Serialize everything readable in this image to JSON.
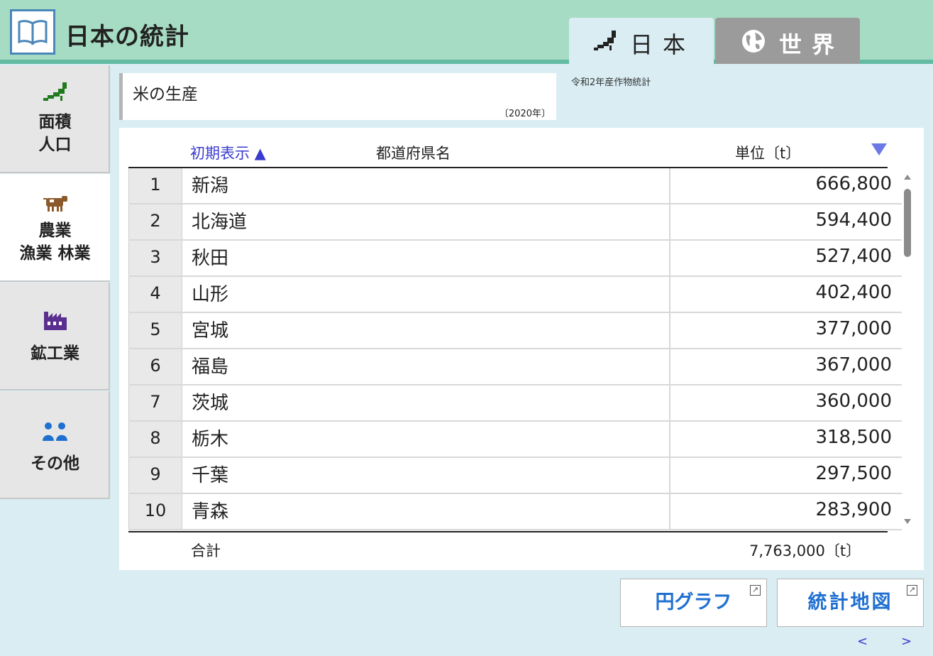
{
  "header": {
    "app_title": "日本の統計",
    "logo_icon": "book-icon",
    "tabs": [
      {
        "label": "日本",
        "icon": "japan-map-icon",
        "active": true
      },
      {
        "label": "世界",
        "icon": "globe-icon",
        "active": false
      }
    ]
  },
  "sidebar": {
    "items": [
      {
        "label_line1": "面積",
        "label_line2": "人口",
        "icon": "japan-map-icon",
        "active": false
      },
      {
        "label_line1": "農業",
        "label_line2": "漁業 林業",
        "icon": "cow-icon",
        "active": true
      },
      {
        "label_line1": "鉱工業",
        "label_line2": "",
        "icon": "factory-icon",
        "active": false
      },
      {
        "label_line1": "その他",
        "label_line2": "",
        "icon": "people-icon",
        "active": false
      }
    ]
  },
  "stat": {
    "title": "米の生産",
    "year": "〔2020年〕",
    "source": "令和2年産作物統計"
  },
  "table": {
    "headers": {
      "sort": "初期表示 ▲",
      "prefecture": "都道府県名",
      "unit": "単位〔t〕"
    },
    "rows": [
      {
        "rank": "1",
        "name": "新潟",
        "value": "666,800"
      },
      {
        "rank": "2",
        "name": "北海道",
        "value": "594,400"
      },
      {
        "rank": "3",
        "name": "秋田",
        "value": "527,400"
      },
      {
        "rank": "4",
        "name": "山形",
        "value": "402,400"
      },
      {
        "rank": "5",
        "name": "宮城",
        "value": "377,000"
      },
      {
        "rank": "6",
        "name": "福島",
        "value": "367,000"
      },
      {
        "rank": "7",
        "name": "茨城",
        "value": "360,000"
      },
      {
        "rank": "8",
        "name": "栃木",
        "value": "318,500"
      },
      {
        "rank": "9",
        "name": "千葉",
        "value": "297,500"
      },
      {
        "rank": "10",
        "name": "青森",
        "value": "283,900"
      }
    ],
    "total_label": "合計",
    "total_value": "7,763,000〔t〕"
  },
  "buttons": {
    "pie_chart": "円グラフ",
    "stat_map": "統計地図"
  },
  "pager": {
    "prev": "<",
    "next": ">"
  },
  "colors": {
    "header_bg": "#a7dcc4",
    "header_rule": "#62bba2",
    "page_bg": "#d9edf3",
    "accent_blue": "#1f6fd1",
    "sort_blue": "#3a3ad0"
  }
}
